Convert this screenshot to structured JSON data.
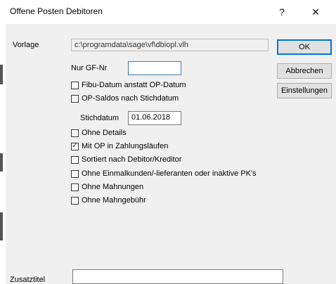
{
  "window": {
    "title": "Offene Posten Debitoren",
    "help_glyph": "?",
    "close_glyph": "✕"
  },
  "form": {
    "vorlage_label": "Vorlage",
    "vorlage_value": "c:\\programdata\\sage\\vf\\dbiopl.vlh",
    "nur_gf_label": "Nur GF-Nr",
    "nur_gf_value": "",
    "stichdatum_label": "Stichdatum",
    "stichdatum_value": "01.06.2018",
    "zusatztitel_label": "Zusatztitel",
    "zusatztitel_value": ""
  },
  "options": [
    {
      "label": "Fibu-Datum anstatt OP-Datum",
      "checked": false
    },
    {
      "label": "OP-Saldos nach Stichdatum",
      "checked": false
    },
    {
      "label": "Ohne Details",
      "checked": false
    },
    {
      "label": "Mit OP in Zahlungsläufen",
      "checked": true
    },
    {
      "label": "Sortiert nach Debitor/Kreditor",
      "checked": false
    },
    {
      "label": "Ohne Einmalkunden/-lieferanten oder inaktive PK's",
      "checked": false
    },
    {
      "label": "Ohne Mahnungen",
      "checked": false
    },
    {
      "label": "Ohne Mahngebühr",
      "checked": false
    }
  ],
  "buttons": {
    "ok": "OK",
    "cancel": "Abbrechen",
    "settings": "Einstellungen"
  }
}
